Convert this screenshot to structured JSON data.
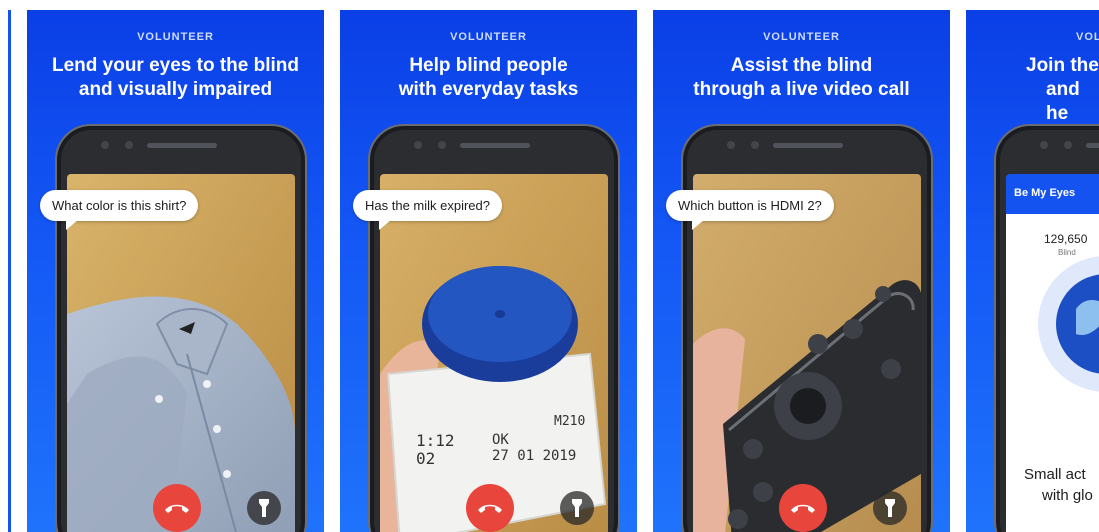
{
  "cards": [
    {
      "eyebrow": "VOLUNTEER",
      "headline_line1": "Lend your eyes to the blind",
      "headline_line2": "and visually impaired",
      "bubble": "What color is this shirt?"
    },
    {
      "eyebrow": "VOLUNTEER",
      "headline_line1": "Help blind people",
      "headline_line2": "with everyday tasks",
      "bubble": "Has the milk expired?",
      "photo_text": {
        "line1": "1:12",
        "line2": "02",
        "ok": "OK",
        "date": "27 01 2019",
        "code": "M210"
      }
    },
    {
      "eyebrow": "VOLUNTEER",
      "headline_line1": "Assist the blind",
      "headline_line2": "through a live video call",
      "bubble": "Which button is HDMI 2?"
    },
    {
      "eyebrow": "VOL",
      "headline_line1": "Join the",
      "headline_line2": "and he",
      "app": {
        "title": "Be My Eyes",
        "stat_value": "129,650",
        "stat_label": "Blind"
      },
      "tagline_line1": "Small act",
      "tagline_line2": "with glo"
    }
  ],
  "colors": {
    "brand_blue": "#1553f0",
    "hangup_red": "#e8463c"
  },
  "icons": [
    "hang-up-icon",
    "flashlight-icon"
  ]
}
